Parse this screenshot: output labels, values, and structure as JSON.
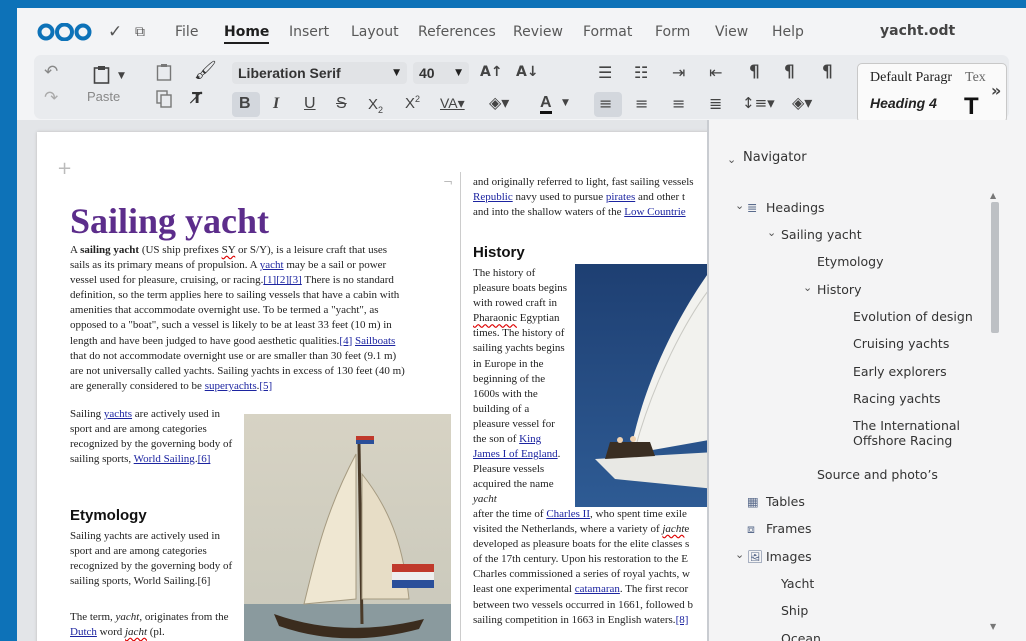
{
  "menubar": {
    "items": [
      "File",
      "Home",
      "Insert",
      "Layout",
      "References",
      "Review",
      "Format",
      "Form",
      "View",
      "Help"
    ],
    "active": "Home",
    "doc_title": "yacht.odt"
  },
  "toolbar": {
    "paste_label": "Paste",
    "font_name": "Liberation Serif",
    "font_size": "40",
    "styles": [
      "Default Paragr",
      "Tex",
      "Heading 4"
    ]
  },
  "document": {
    "title": "Sailing yacht",
    "intro_html": "A <b>sailing yacht</b> (US ship prefixes <span class='sq'>SY</span> or S/Y), is a leisure craft that uses sails as its primary means of propulsion. A <a>yacht</a> may be a sail or power vessel used for pleasure, cruising, or racing.<a>[1]</a><a>[2]</a><a>[3]</a> There is no standard definition, so the term applies here to sailing vessels that have a cabin with amenities that accommodate overnight use. To be termed a \"yacht\", as opposed to a \"boat\", such a vessel is likely to be at least 33 feet (10 m) in length and have been judged to have good aesthetic qualities.<a>[4]</a> <a>Sailboats</a> that do not accommodate overnight use or are smaller than 30 feet (9.1 m) are not universally called yachts. Sailing yachts in excess of 130 feet (40 m) are generally considered to be <a>superyachts</a>.<a>[5]</a>",
    "sport_html": "Sailing <a>yachts</a> are actively used in sport and are among categories recognized by the governing body of sailing sports, <a>World Sailing</a>.<a>[6]</a>",
    "etymology_heading": "Etymology",
    "etymology_html": "Sailing yachts are actively used in sport and are among categories recognized by the governing body of sailing sports, World Sailing.[6]",
    "term_html": "The term, <i>yacht</i>, originates from the <a>Dutch</a> word <span class='sq'><i>jacht</i></span> (pl.",
    "col2_top_html": "and originally referred to light, fast sailing vessels<br><a>Republic</a> navy used to pursue <a>pirates</a> and other t<br>and into the shallow waters of the <a>Low Countrie</a>",
    "history_heading": "History",
    "history_html": "The history of pleasure boats begins with rowed craft in <span class='sq'>Pharaonic</span> Egyptian times. The history of sailing yachts begins in Europe in the beginning of the 1600s with the building of a pleasure vessel for the son of <a>King James I of England</a>. Pleasure vessels acquired the name <i>yacht</i>",
    "history_cont_html": "after the time of <a>Charles II</a>, who spent time exile<br>visited the Netherlands, where a variety of <span class='sq'><i>jacht</i></span>e<br>developed as pleasure boats for the elite classes s<br>of the 17th century. Upon his restoration to the E<br>Charles commissioned a series of royal yachts, w<br>least one experimental <a>catamaran</a>. The first recor<br>between two vessels occurred in 1661, followed b<br>sailing competition in 1663 in English waters.<a>[8]</a>"
  },
  "navigator": {
    "title": "Navigator",
    "items": [
      {
        "label": "Headings",
        "level": 0,
        "expanded": true,
        "icon": "headings-icon"
      },
      {
        "label": "Sailing yacht",
        "level": 1,
        "expanded": true
      },
      {
        "label": "Etymology",
        "level": 2
      },
      {
        "label": "History",
        "level": 2,
        "expanded": true
      },
      {
        "label": "Evolution of design",
        "level": 3
      },
      {
        "label": "Cruising yachts",
        "level": 3
      },
      {
        "label": "Early explorers",
        "level": 3
      },
      {
        "label": "Racing yachts",
        "level": 3
      },
      {
        "label": "The International Offshore Racing",
        "level": 3
      },
      {
        "label": "Source and photo’s",
        "level": 2
      },
      {
        "label": "Tables",
        "level": 0,
        "icon": "table-icon"
      },
      {
        "label": "Frames",
        "level": 0,
        "icon": "frame-icon"
      },
      {
        "label": "Images",
        "level": 0,
        "expanded": true,
        "icon": "image-icon"
      },
      {
        "label": "Yacht",
        "level": 1
      },
      {
        "label": "Ship",
        "level": 1
      },
      {
        "label": "Ocean",
        "level": 1
      }
    ]
  },
  "colors": {
    "accent": "#0d72b8",
    "title": "#5c2d8b",
    "link": "#1c24a0"
  }
}
